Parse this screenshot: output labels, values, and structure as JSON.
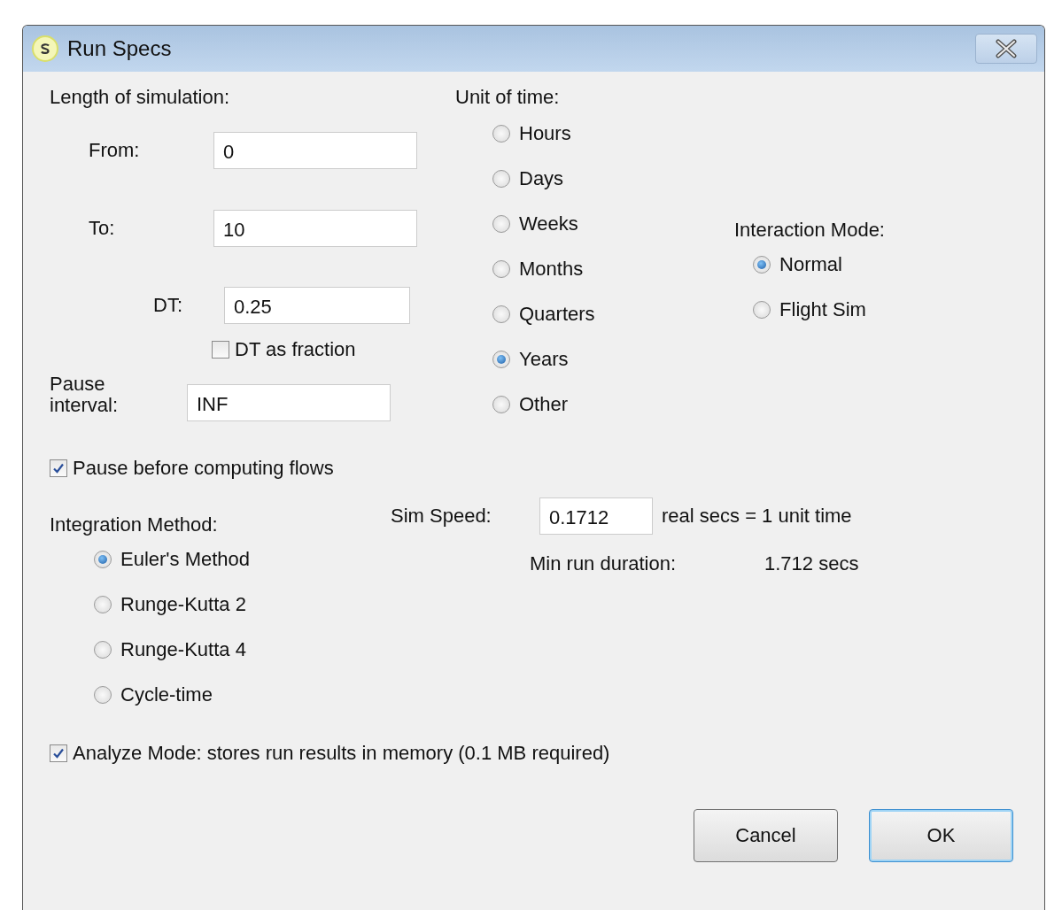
{
  "window": {
    "title": "Run Specs"
  },
  "length": {
    "label": "Length of simulation:",
    "fields": [
      {
        "label": "From:",
        "value": "0"
      },
      {
        "label": "To:",
        "value": "10"
      },
      {
        "label": "DT:",
        "value": "0.25"
      }
    ],
    "dt_fraction": {
      "label": "DT as fraction",
      "checked": false
    },
    "pause": {
      "label": "Pause interval:",
      "value": "INF"
    }
  },
  "unit_of_time": {
    "label": "Unit of time:",
    "options": [
      {
        "label": "Hours",
        "selected": false
      },
      {
        "label": "Days",
        "selected": false
      },
      {
        "label": "Weeks",
        "selected": false
      },
      {
        "label": "Months",
        "selected": false
      },
      {
        "label": "Quarters",
        "selected": false
      },
      {
        "label": "Years",
        "selected": true
      },
      {
        "label": "Other",
        "selected": false
      }
    ]
  },
  "interaction_mode": {
    "label": "Interaction Mode:",
    "options": [
      {
        "label": "Normal",
        "selected": true
      },
      {
        "label": "Flight Sim",
        "selected": false
      }
    ]
  },
  "pause_before_flows": {
    "label": "Pause before computing flows",
    "checked": true
  },
  "integration": {
    "label": "Integration Method:",
    "options": [
      {
        "label": "Euler's Method",
        "selected": true
      },
      {
        "label": "Runge-Kutta 2",
        "selected": false
      },
      {
        "label": "Runge-Kutta 4",
        "selected": false
      },
      {
        "label": "Cycle-time",
        "selected": false
      }
    ]
  },
  "sim_speed": {
    "label": "Sim Speed:",
    "value": "0.1712",
    "unit": "real secs = 1 unit time"
  },
  "min_run": {
    "label": "Min run duration:",
    "value": "1.712 secs"
  },
  "analyze": {
    "label": "Analyze Mode: stores run results in memory (0.1 MB required)",
    "checked": true
  },
  "buttons": [
    {
      "label": "Cancel",
      "default": false
    },
    {
      "label": "OK",
      "default": true
    }
  ]
}
